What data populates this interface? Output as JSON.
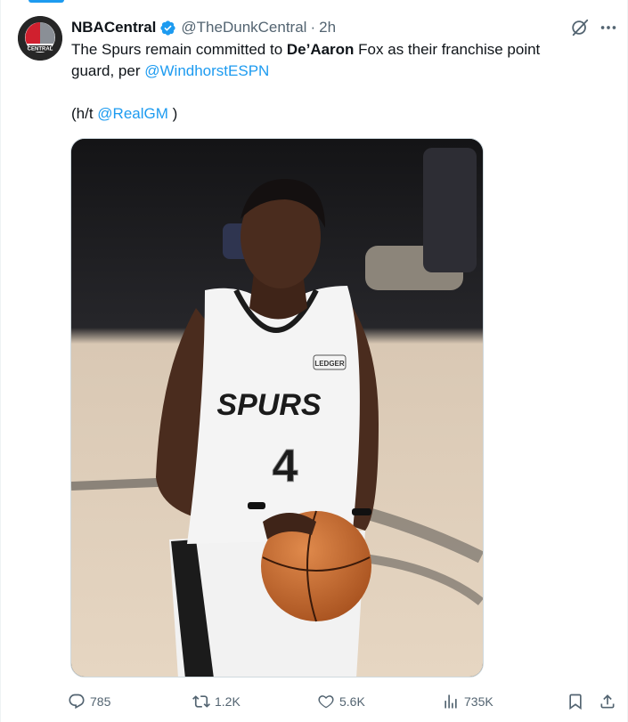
{
  "tweet": {
    "display_name": "NBACentral",
    "handle": "@TheDunkCentral",
    "separator": "·",
    "time": "2h",
    "avatar_text": "CENTRAL",
    "text": {
      "line1_a": "The Spurs remain committed to ",
      "line1_bold": "De’Aaron",
      "line1_b": " Fox as their franchise point",
      "line2_a": "guard, per ",
      "line2_mention": "@WindhorstESPN",
      "line3_a": "(h/t ",
      "line3_mention": "@RealGM",
      "line3_b": " )"
    },
    "media": {
      "jersey_text": "SPURS",
      "jersey_number": "4",
      "patch_text": "LEDGER"
    }
  },
  "actions": {
    "replies": "785",
    "reposts": "1.2K",
    "likes": "5.6K",
    "views": "735K"
  },
  "icons": {
    "verified": "verified-badge-icon",
    "grok": "grok-icon",
    "more": "more-icon",
    "reply": "reply-icon",
    "repost": "repost-icon",
    "like": "heart-icon",
    "views": "views-icon",
    "bookmark": "bookmark-icon",
    "share": "share-icon"
  },
  "colors": {
    "accent": "#1d9bf0",
    "text": "#0f1419",
    "muted": "#536471"
  }
}
